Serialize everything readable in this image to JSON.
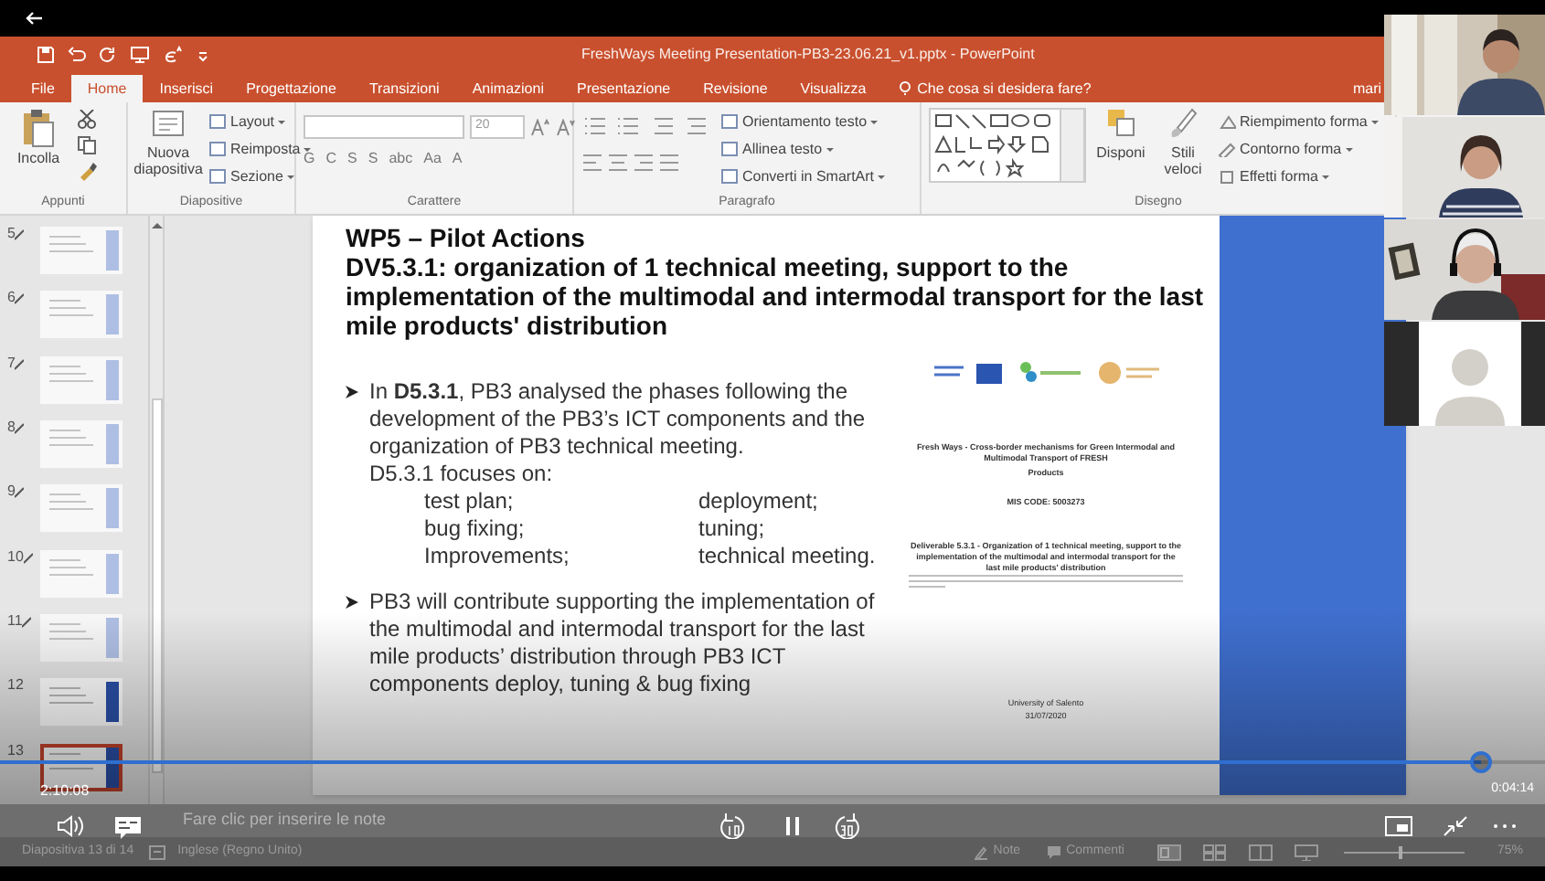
{
  "window": {
    "title": "FreshWays Meeting Presentation-PB3-23.06.21_v1.pptx - PowerPoint"
  },
  "tabs": [
    {
      "label": "File",
      "selected": false
    },
    {
      "label": "Home",
      "selected": true
    },
    {
      "label": "Inserisci",
      "selected": false
    },
    {
      "label": "Progettazione",
      "selected": false
    },
    {
      "label": "Transizioni",
      "selected": false
    },
    {
      "label": "Animazioni",
      "selected": false
    },
    {
      "label": "Presentazione",
      "selected": false
    },
    {
      "label": "Revisione",
      "selected": false
    },
    {
      "label": "Visualizza",
      "selected": false
    }
  ],
  "tell_me": {
    "placeholder": "Che cosa si desidera fare?"
  },
  "user": "mari",
  "ribbon": {
    "groups": [
      {
        "kind": "clipboard",
        "label": "Appunti",
        "large": [
          "Incolla"
        ]
      },
      {
        "kind": "slides",
        "label": "Diapositive",
        "large": [
          "Nuova diapositiva"
        ],
        "small": [
          "Layout",
          "Reimposta",
          "Sezione"
        ]
      },
      {
        "kind": "font",
        "label": "Carattere",
        "font_size": "20",
        "glyphs": [
          "G",
          "C",
          "S",
          "S",
          "abc",
          "Aa",
          "A"
        ]
      },
      {
        "kind": "paragraph",
        "label": "Paragrafo",
        "small": [
          "Orientamento testo",
          "Allinea testo",
          "Converti in SmartArt"
        ]
      },
      {
        "kind": "drawing",
        "label": "Disegno",
        "large": [
          "Disponi",
          "Stili veloci"
        ],
        "small": [
          "Riempimento forma",
          "Contorno forma",
          "Effetti forma"
        ]
      }
    ]
  },
  "thumbnails": [
    {
      "number": "5",
      "hidden": true,
      "selected": false
    },
    {
      "number": "6",
      "hidden": true,
      "selected": false
    },
    {
      "number": "7",
      "hidden": true,
      "selected": false
    },
    {
      "number": "8",
      "hidden": true,
      "selected": false
    },
    {
      "number": "9",
      "hidden": true,
      "selected": false
    },
    {
      "number": "10",
      "hidden": true,
      "selected": false
    },
    {
      "number": "11",
      "hidden": true,
      "selected": false
    },
    {
      "number": "12",
      "hidden": false,
      "selected": false
    },
    {
      "number": "13",
      "hidden": false,
      "selected": true
    }
  ],
  "slide": {
    "heading": "WP5 – Pilot Actions",
    "title": "DV5.3.1: organization of 1 technical meeting, support to the implementation of the multimodal and intermodal transport for the last mile products' distribution",
    "bullets": [
      {
        "text": "In **D5.3.1**, PB3 analysed the phases following the development of the PB3’s ICT components and the organization of PB3 technical meeting.",
        "lead": "D5.3.1 focuses on:",
        "items": [
          "test plan;",
          "deployment;",
          "bug fixing;",
          "tuning;",
          "Improvements;",
          "technical meeting."
        ]
      },
      {
        "text": "PB3 will contribute supporting the implementation of the multimodal and intermodal transport for the last mile products’ distribution through PB3 ICT components deploy, tuning & bug fixing"
      }
    ],
    "document": {
      "title": "Fresh Ways - Cross-border mechanisms for Green Intermodal and Multimodal Transport of FRESH",
      "subtitle": "Products",
      "code": "MIS CODE: 5003273",
      "deliverable": "Deliverable 5.3.1 - Organization of 1 technical meeting, support to the implementation of the multimodal and intermodal transport for the last mile products' distribution",
      "institution": "University of Salento",
      "date": "31/07/2020"
    }
  },
  "notes": {
    "placeholder": "Fare clic per inserire le note"
  },
  "status_bar": {
    "slide": "Diapositiva 13 di 14",
    "language": "Inglese (Regno Unito)",
    "notes": "Note",
    "comments": "Commenti",
    "zoom": "75%",
    "zoom_level": {
      "level": 0.45
    }
  },
  "player": {
    "elapsed": "2:10:08",
    "remaining": "0:04:14",
    "level": 0.958
  },
  "participants": [
    {
      "kind": "video"
    },
    {
      "kind": "video"
    },
    {
      "kind": "video"
    },
    {
      "kind": "avatar"
    }
  ]
}
